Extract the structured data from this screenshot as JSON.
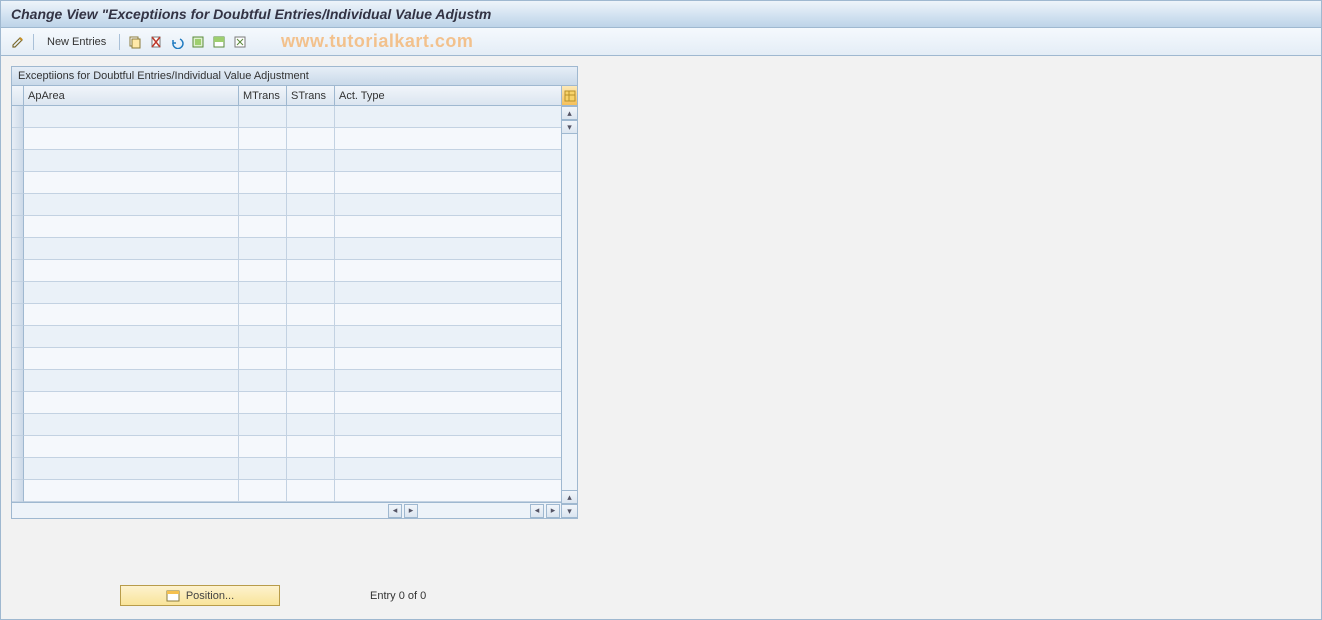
{
  "title": "Change View \"Exceptiions for Doubtful Entries/Individual Value Adjustm",
  "toolbar": {
    "new_entries_label": "New Entries"
  },
  "watermark": "www.tutorialkart.com",
  "table": {
    "caption": "Exceptiions for Doubtful Entries/Individual Value Adjustment",
    "columns": {
      "aparea": "ApArea",
      "mtrans": "MTrans",
      "strans": "STrans",
      "acttype": "Act. Type"
    },
    "rows": []
  },
  "footer": {
    "position_label": "Position...",
    "entry_status": "Entry 0 of 0"
  }
}
